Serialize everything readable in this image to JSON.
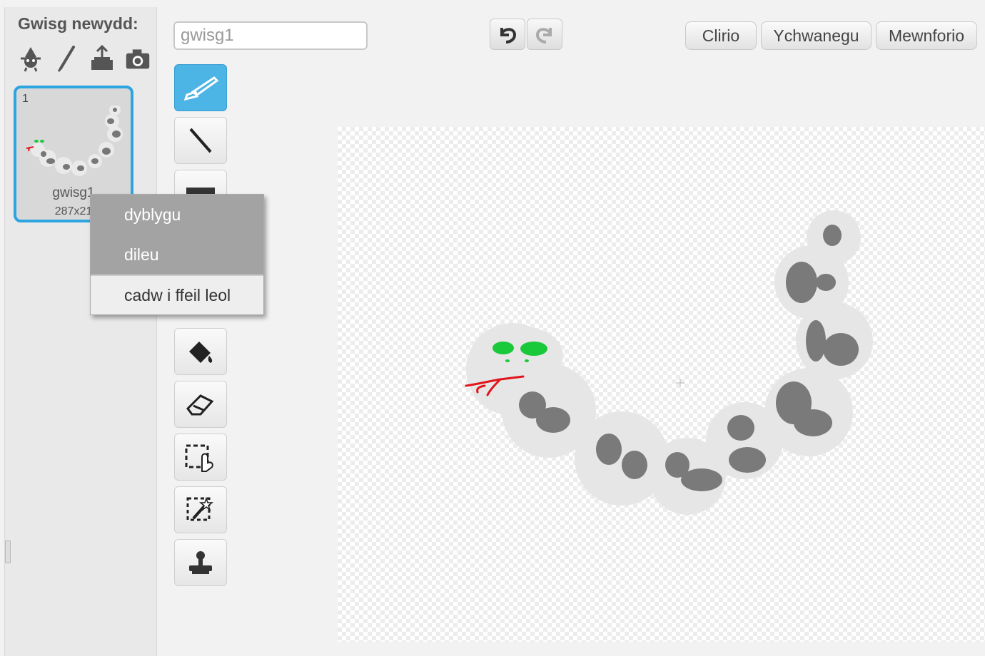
{
  "left_pane": {
    "new_costume_label": "Gwisg newydd:",
    "costume": {
      "number": "1",
      "name": "gwisg1",
      "size": "287x21"
    }
  },
  "context_menu": {
    "items": [
      "dyblygu",
      "dileu",
      "cadw i ffeil leol"
    ]
  },
  "editor": {
    "costume_name_value": "gwisg1",
    "buttons": {
      "clear": "Clirio",
      "add": "Ychwanegu",
      "import": "Mewnforio"
    }
  },
  "colors": {
    "accent": "#4db4e6",
    "selection_border": "#2da5e1",
    "snake_body": "#e5e5e5",
    "snake_spots": "#7a7a7a",
    "eyes": "#19c93a",
    "tongue": "#e0151b"
  },
  "icons": {
    "new_costume": [
      "sprite-library-icon",
      "paint-icon",
      "upload-icon",
      "camera-icon"
    ],
    "tools": [
      "brush-icon",
      "line-icon",
      "rectangle-icon",
      "fill-icon",
      "eraser-icon",
      "select-icon",
      "magic-select-icon",
      "stamp-icon"
    ]
  }
}
